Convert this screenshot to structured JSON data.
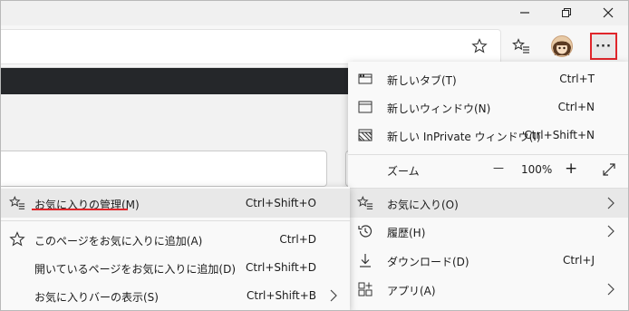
{
  "window": {
    "minimize_icon": "minimize-icon",
    "restore_icon": "restore-icon",
    "close_icon": "close-icon"
  },
  "toolbar": {
    "favorite_star_icon": "star-add-icon",
    "favorites_icon": "favorites-list-icon",
    "profile_icon": "avatar",
    "more_label": "···"
  },
  "main_menu": {
    "new_tab": {
      "label": "新しいタブ(T)",
      "shortcut": "Ctrl+T"
    },
    "new_window": {
      "label": "新しいウィンドウ(N)",
      "shortcut": "Ctrl+N"
    },
    "new_inprivate": {
      "label": "新しい InPrivate ウィンドウ(I)",
      "shortcut": "Ctrl+Shift+N"
    },
    "zoom": {
      "label": "ズーム",
      "minus": "—",
      "value": "100%",
      "plus": "+"
    },
    "favorites": {
      "label": "お気に入り(O)"
    },
    "history": {
      "label": "履歴(H)"
    },
    "downloads": {
      "label": "ダウンロード(D)",
      "shortcut": "Ctrl+J"
    },
    "apps": {
      "label": "アプリ(A)"
    }
  },
  "favorites_submenu": {
    "manage": {
      "label": "お気に入りの管理(M)",
      "shortcut": "Ctrl+Shift+O"
    },
    "add_page": {
      "label": "このページをお気に入りに追加(A)",
      "shortcut": "Ctrl+D"
    },
    "add_open_pages": {
      "label": "開いているページをお気に入りに追加(D)",
      "shortcut": "Ctrl+Shift+D"
    },
    "show_bar": {
      "label": "お気に入りバーの表示(S)",
      "shortcut": "Ctrl+Shift+B"
    }
  },
  "colors": {
    "highlight_border": "#e0262b"
  }
}
